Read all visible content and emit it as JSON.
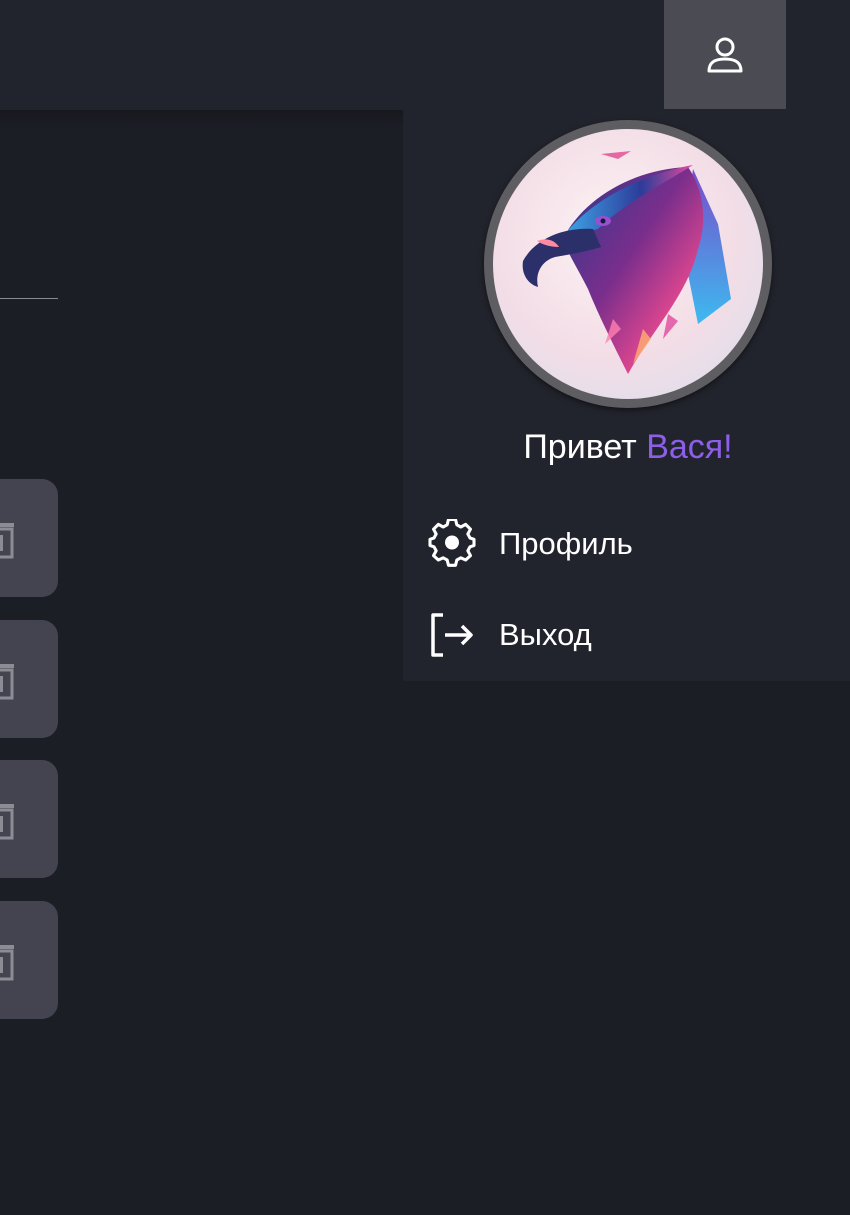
{
  "header": {
    "user_icon": "user-icon"
  },
  "list": {
    "cards": [
      {
        "icon": "trash-icon"
      },
      {
        "icon": "trash-icon"
      },
      {
        "icon": "trash-icon"
      },
      {
        "icon": "trash-icon"
      }
    ]
  },
  "user_menu": {
    "greeting_prefix": "Привет",
    "user_name": "Вася!",
    "items": [
      {
        "label": "Профиль",
        "icon": "gear-icon"
      },
      {
        "label": "Выход",
        "icon": "logout-icon"
      }
    ]
  },
  "colors": {
    "background": "#1c1e26",
    "panel": "#22242d",
    "accent": "#8d5fe8",
    "card": "#43444f",
    "user_button": "#4a4b53"
  }
}
